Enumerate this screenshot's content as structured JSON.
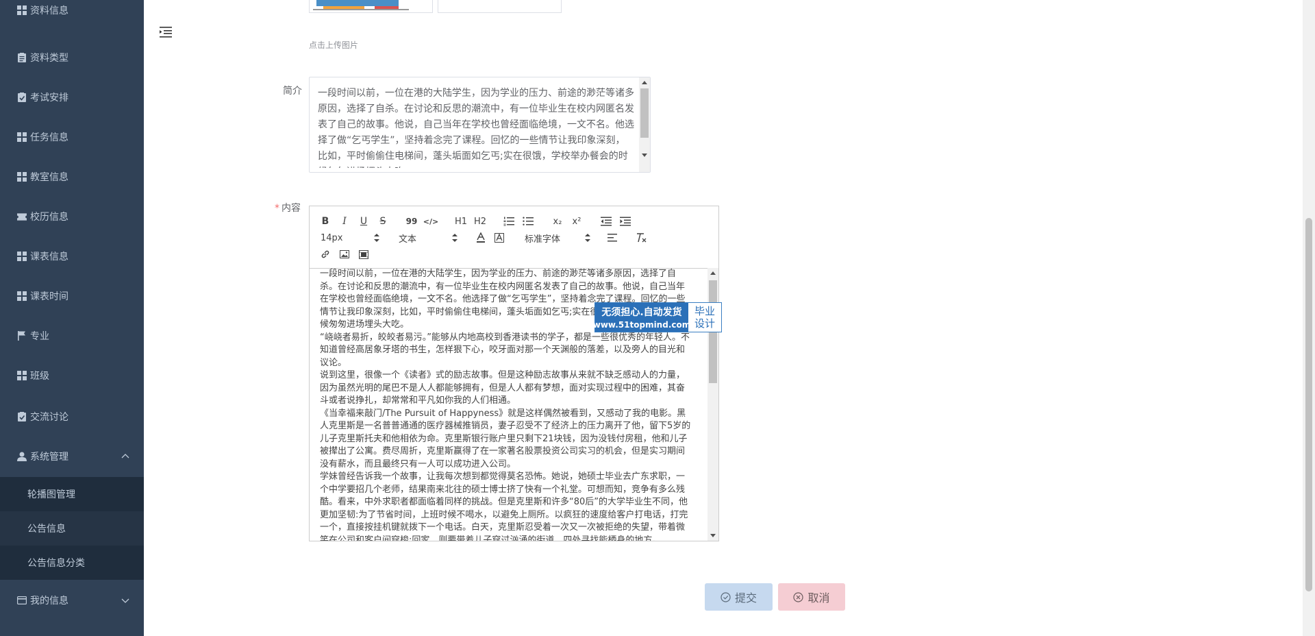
{
  "sidebar": {
    "items": [
      {
        "label": "资料信息",
        "icon": "grid-icon"
      },
      {
        "label": "资料类型",
        "icon": "clipboard-icon"
      },
      {
        "label": "考试安排",
        "icon": "checklist-icon"
      },
      {
        "label": "任务信息",
        "icon": "grid-icon"
      },
      {
        "label": "教室信息",
        "icon": "grid-icon"
      },
      {
        "label": "校历信息",
        "icon": "ticket-icon"
      },
      {
        "label": "课表信息",
        "icon": "grid-icon"
      },
      {
        "label": "课表时间",
        "icon": "grid-icon"
      },
      {
        "label": "专业",
        "icon": "flag-icon"
      },
      {
        "label": "班级",
        "icon": "grid-icon"
      },
      {
        "label": "交流讨论",
        "icon": "checklist-icon"
      },
      {
        "label": "系统管理",
        "icon": "user-icon"
      }
    ],
    "submenu": [
      {
        "label": "轮播图管理"
      },
      {
        "label": "公告信息"
      },
      {
        "label": "公告信息分类"
      }
    ],
    "my_info": {
      "label": "我的信息",
      "icon": "card-icon"
    }
  },
  "form": {
    "upload_tip": "点击上传图片",
    "intro_label": "简介",
    "intro_text": "一段时间以前，一位在港的大陆学生，因为学业的压力、前途的渺茫等诸多原因，选择了自杀。在讨论和反思的潮流中，有一位毕业生在校内网匿名发表了自己的故事。他说，自己当年在学校也曾经面临绝境，一文不名。他选择了做“乞丐学生”，坚持着念完了课程。回忆的一些情节让我印象深刻，比如，平时偷偷住电梯间，蓬头垢面如乞丐;实在很饿，学校举办餐会的时候匆匆进场埋头大吃",
    "content_required_mark": "*",
    "content_label": "内容",
    "editor": {
      "toolbar": {
        "bold": "B",
        "italic": "I",
        "underline": "U",
        "strike": "S",
        "blockquote": "99",
        "code": "</>",
        "h1": "H1",
        "h2": "H2",
        "sub": "x₂",
        "sup": "x²",
        "size": "14px",
        "header": "文本",
        "font": "标准字体"
      },
      "paragraphs": [
        "一段时间以前，一位在港的大陆学生，因为学业的压力、前途的渺茫等诸多原因，选择了自杀。在讨论和反思的潮流中，有一位毕业生在校内网匿名发表了自己的故事。他说，自己当年在学校也曾经面临绝境，一文不名。他选择了做“乞丐学生”，坚持着念完了课程。回忆的一些情节让我印象深刻，比如，平时偷偷住电梯间，蓬头垢面如乞丐;实在很饿，学校举办餐会的时候匆匆进场埋头大吃。",
        "“峣峣者易折，皎皎者易污。”能够从内地高校到香港读书的学子，都是一些很优秀的年轻人。不知道曾经高居象牙塔的书生，怎样狠下心，咬牙面对那一个天渊般的落差，以及旁人的目光和议论。",
        "说到这里，很像一个《读者》式的励志故事。但是这种励志故事从来就不缺乏感动人的力量，因为虽然光明的尾巴不是人人都能够拥有，但是人人都有梦想，面对实现过程中的困难，其奋斗或者说挣扎，却常常和平凡如你我的人们相通。",
        "《当幸福来敲门/The Pursuit of Happyness》就是这样偶然被看到，又感动了我的电影。黑人克里斯是一名普普通通的医疗器械推销员，妻子忍受不了经济上的压力离开了他，留下5岁的儿子克里斯托夫和他相依为命。克里斯银行账户里只剩下21块钱，因为没钱付房租，他和儿子被撵出了公寓。费尽周折，克里斯赢得了在一家著名股票投资公司实习的机会，但是实习期间没有薪水，而且最终只有一人可以成功进入公司。",
        "学妹曾经告诉我一个故事，让我每次想到都觉得莫名恐怖。她说，她硕士毕业去广东求职，一个中学要招几个老师，结果南来北往的硕士博士挤了快有一个礼堂。可想而知，竞争有多么残酷。看来，中外求职者都面临着同样的挑战。但是克里斯和许多“80后”的大学毕业生不同，他更加坚韧:为了节省时间，上班时候不喝水，以避免上厕所。以疯狂的速度给客户打电话，打完一个，直接按挂机键就拨下一个电话。白天，克里斯忍受着一次又一次被拒绝的失望，带着微笑在公司和客户间穿梭;回家，则要带着儿子穿过汹涌的街道，四处寻找能栖身的地方。"
      ]
    },
    "ad": {
      "line1": "无须担心.自动发货",
      "url": "www.51topmind.com",
      "right1": "毕业",
      "right2": "设计"
    },
    "submit_label": "提交",
    "cancel_label": "取消"
  }
}
